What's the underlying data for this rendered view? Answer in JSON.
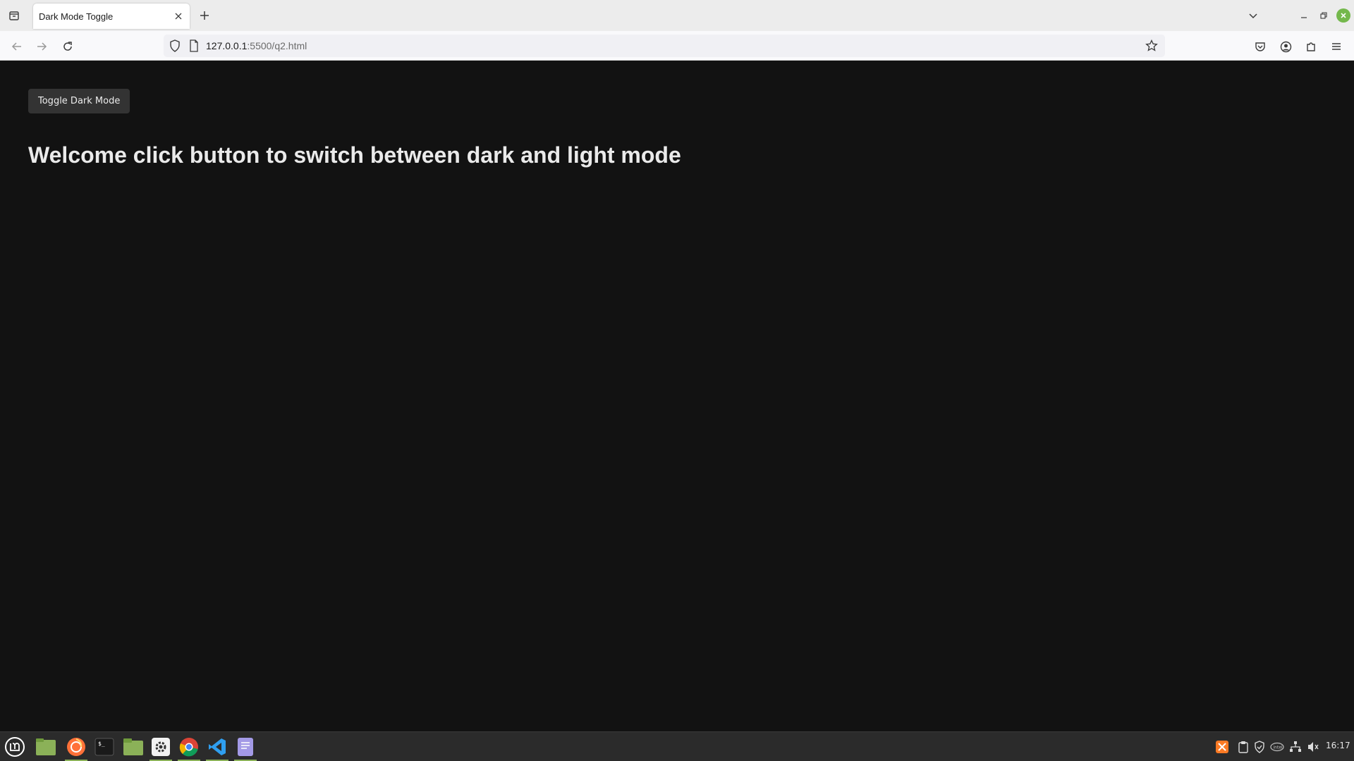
{
  "browser": {
    "tab_title": "Dark Mode Toggle",
    "url_host": "127.0.0.1",
    "url_path": ":5500/q2.html"
  },
  "page": {
    "toggle_button_label": "Toggle Dark Mode",
    "headline": "Welcome click button to switch between dark and light mode",
    "background_color": "#121212",
    "text_color": "#eaeaea",
    "button_color": "#333333"
  },
  "taskbar": {
    "apps": [
      "mint-menu-icon",
      "desktop-folder-icon",
      "firefox-icon",
      "terminal-icon",
      "files-icon",
      "settings-icon",
      "chrome-icon",
      "vscode-icon",
      "text-editor-icon"
    ],
    "clock": "16:17"
  }
}
